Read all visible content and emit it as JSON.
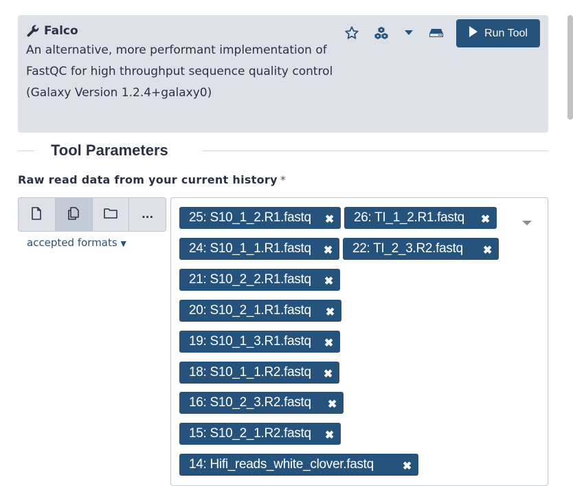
{
  "tool": {
    "name": "Falco",
    "description": "An alternative, more performant implementation of FastQC for high throughput sequence quality control",
    "version": "(Galaxy Version 1.2.4+galaxy0)",
    "run_label": "Run Tool",
    "icons": [
      "star-icon",
      "cubes-icon",
      "caret-down-icon",
      "hdd-icon"
    ]
  },
  "section": {
    "title": "Tool Parameters"
  },
  "param": {
    "label": "Raw read data from your current history",
    "required_mark": "*",
    "accepted_formats": "accepted formats",
    "mode_buttons": [
      "single-dataset",
      "multiple-datasets",
      "dataset-collection",
      "more-options"
    ],
    "more_label": "..."
  },
  "selected_datasets": [
    "25: S10_1_2.R1.fastq",
    "26: TI_1_2.R1.fastq",
    "24: S10_1_1.R1.fastq",
    "22: TI_2_3.R2.fastq",
    "21: S10_2_2.R1.fastq",
    "20: S10_2_1.R1.fastq",
    "19: S10_1_3.R1.fastq",
    "18: S10_1_1.R2.fastq",
    "16: S10_2_3.R2.fastq",
    "15: S10_2_1.R2.fastq",
    "14: Hifi_reads_white_clover.fastq"
  ],
  "remove_glyph": "✖",
  "colors": {
    "header_bg": "#dee2e8",
    "primary": "#25537b",
    "text": "#2c3143"
  }
}
